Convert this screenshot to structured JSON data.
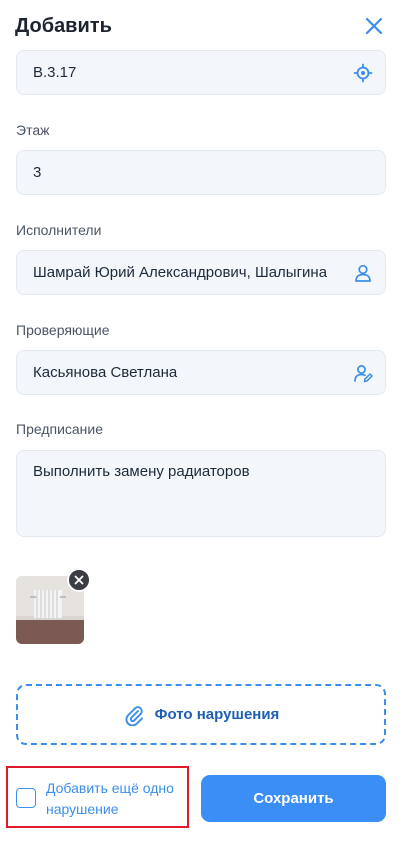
{
  "header": {
    "title": "Добавить"
  },
  "location": {
    "value": "В.3.17",
    "icon": "crosshair-icon"
  },
  "floor": {
    "label": "Этаж",
    "value": "3"
  },
  "executors": {
    "label": "Исполнители",
    "value": "Шамрай Юрий Александрович, Шалыгина",
    "icon": "person-icon"
  },
  "reviewers": {
    "label": "Проверяющие",
    "value": "Касьянова Светлана",
    "icon": "person-edit-icon"
  },
  "prescription": {
    "label": "Предписание",
    "value": "Выполнить замену радиаторов"
  },
  "photo_button": {
    "label": "Фото нарушения",
    "icon": "paperclip-icon"
  },
  "add_another": {
    "label": "Добавить ещё одно нарушение",
    "checked": false
  },
  "save": {
    "label": "Сохранить"
  },
  "colors": {
    "accent": "#3a8ef6",
    "highlight": "#e0192b",
    "field_bg": "#f3f7fb"
  }
}
